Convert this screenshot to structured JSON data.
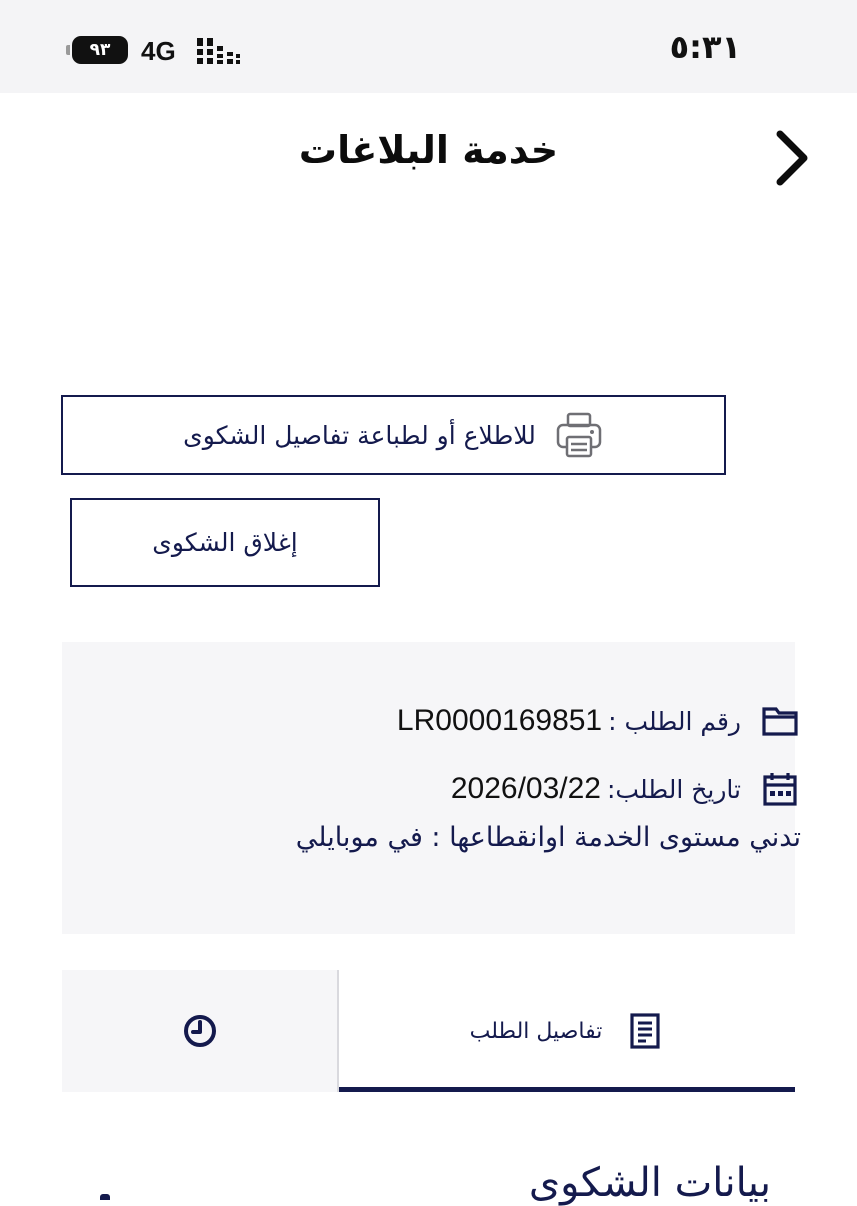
{
  "status_bar": {
    "time": "٥:٣١",
    "network": "4G",
    "battery": "٩٣"
  },
  "header": {
    "title": "خدمة البلاغات",
    "back_icon": "chevron-right-icon"
  },
  "actions": {
    "print_label": "للاطلاع أو لطباعة تفاصيل الشكوى",
    "print_icon": "printer-icon",
    "close_label": "إغلاق الشكوى"
  },
  "request": {
    "number_label": "رقم الطلب :",
    "number_value": "LR0000169851",
    "date_label": "تاريخ الطلب:",
    "date_value": "2026/03/22",
    "complaint_type": "تدني مستوى الخدمة اوانقطاعها : في موبايلي"
  },
  "tabs": {
    "details_label": "تفاصيل الطلب",
    "details_icon": "document-list-icon",
    "history_icon": "clock-icon"
  },
  "section": {
    "title": "بيانات الشكوى"
  },
  "colors": {
    "primary": "#141a4d",
    "card_bg": "#f6f6f8",
    "status_bg": "#f4f4f6"
  }
}
